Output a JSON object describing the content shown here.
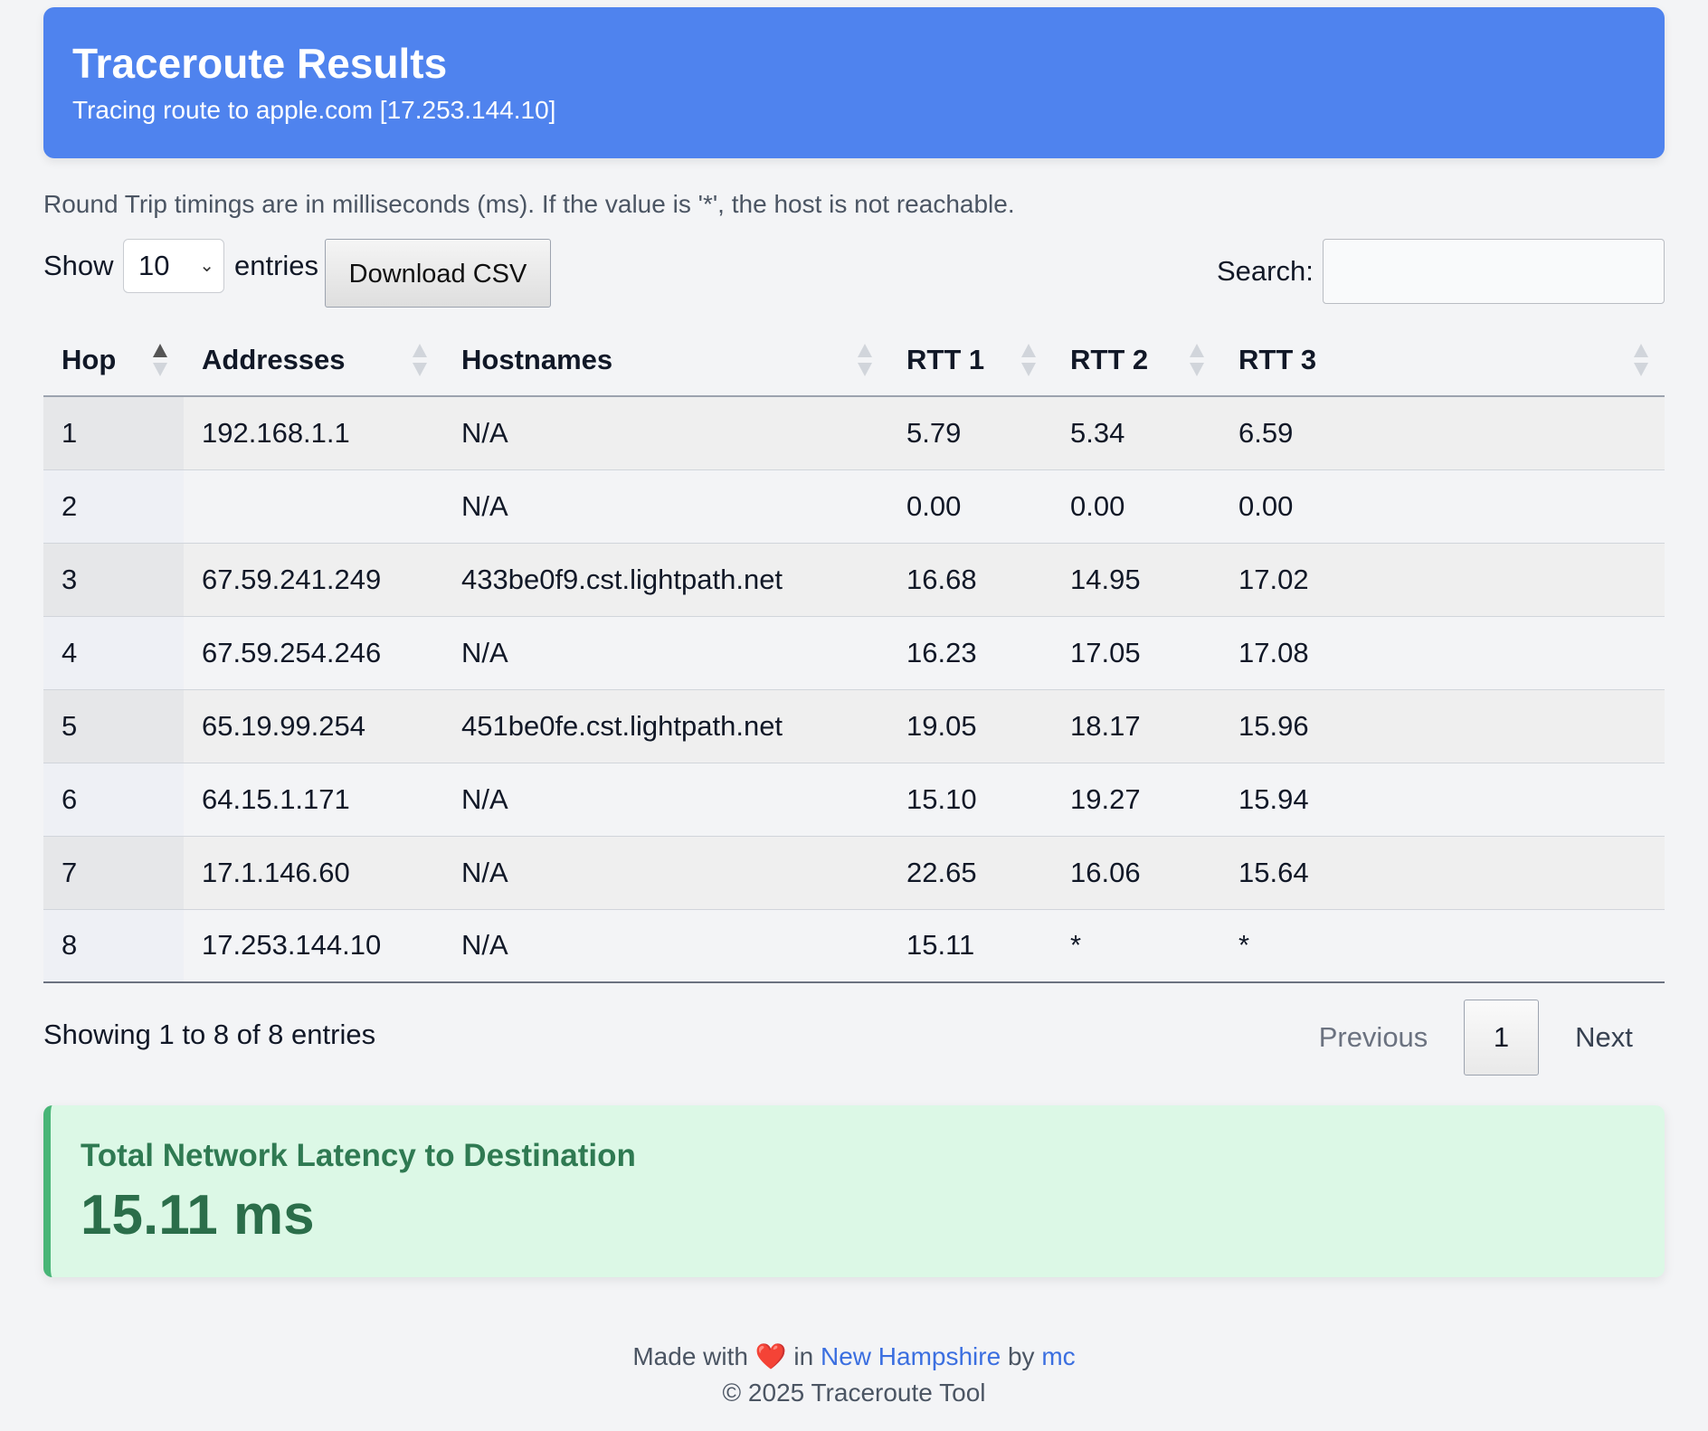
{
  "header": {
    "title": "Traceroute Results",
    "subtitle": "Tracing route to apple.com [17.253.144.10]"
  },
  "note": "Round Trip timings are in milliseconds (ms). If the value is '*', the host is not reachable.",
  "controls": {
    "show_label": "Show",
    "page_size": "10",
    "entries_label": "entries",
    "download_label": "Download CSV",
    "search_label": "Search:",
    "search_value": ""
  },
  "table": {
    "columns": [
      "Hop",
      "Addresses",
      "Hostnames",
      "RTT 1",
      "RTT 2",
      "RTT 3"
    ],
    "rows": [
      [
        "1",
        "192.168.1.1",
        "N/A",
        "5.79",
        "5.34",
        "6.59"
      ],
      [
        "2",
        "",
        "N/A",
        "0.00",
        "0.00",
        "0.00"
      ],
      [
        "3",
        "67.59.241.249",
        "433be0f9.cst.lightpath.net",
        "16.68",
        "14.95",
        "17.02"
      ],
      [
        "4",
        "67.59.254.246",
        "N/A",
        "16.23",
        "17.05",
        "17.08"
      ],
      [
        "5",
        "65.19.99.254",
        "451be0fe.cst.lightpath.net",
        "19.05",
        "18.17",
        "15.96"
      ],
      [
        "6",
        "64.15.1.171",
        "N/A",
        "15.10",
        "19.27",
        "15.94"
      ],
      [
        "7",
        "17.1.146.60",
        "N/A",
        "22.65",
        "16.06",
        "15.64"
      ],
      [
        "8",
        "17.253.144.10",
        "N/A",
        "15.11",
        "*",
        "*"
      ]
    ]
  },
  "pagination": {
    "info": "Showing 1 to 8 of 8 entries",
    "previous": "Previous",
    "current_page": "1",
    "next": "Next"
  },
  "latency": {
    "title": "Total Network Latency to Destination",
    "value": "15.11 ms"
  },
  "footer": {
    "made_with": "Made with",
    "heart": "❤️",
    "in": "in",
    "location": "New Hampshire",
    "by": "by",
    "author": "mc",
    "copyright": "© 2025 Traceroute Tool"
  },
  "colors": {
    "header_bg": "#4f83ee",
    "latency_bg": "#dcf8e6",
    "latency_accent": "#48b577",
    "link": "#3b6fe0"
  }
}
